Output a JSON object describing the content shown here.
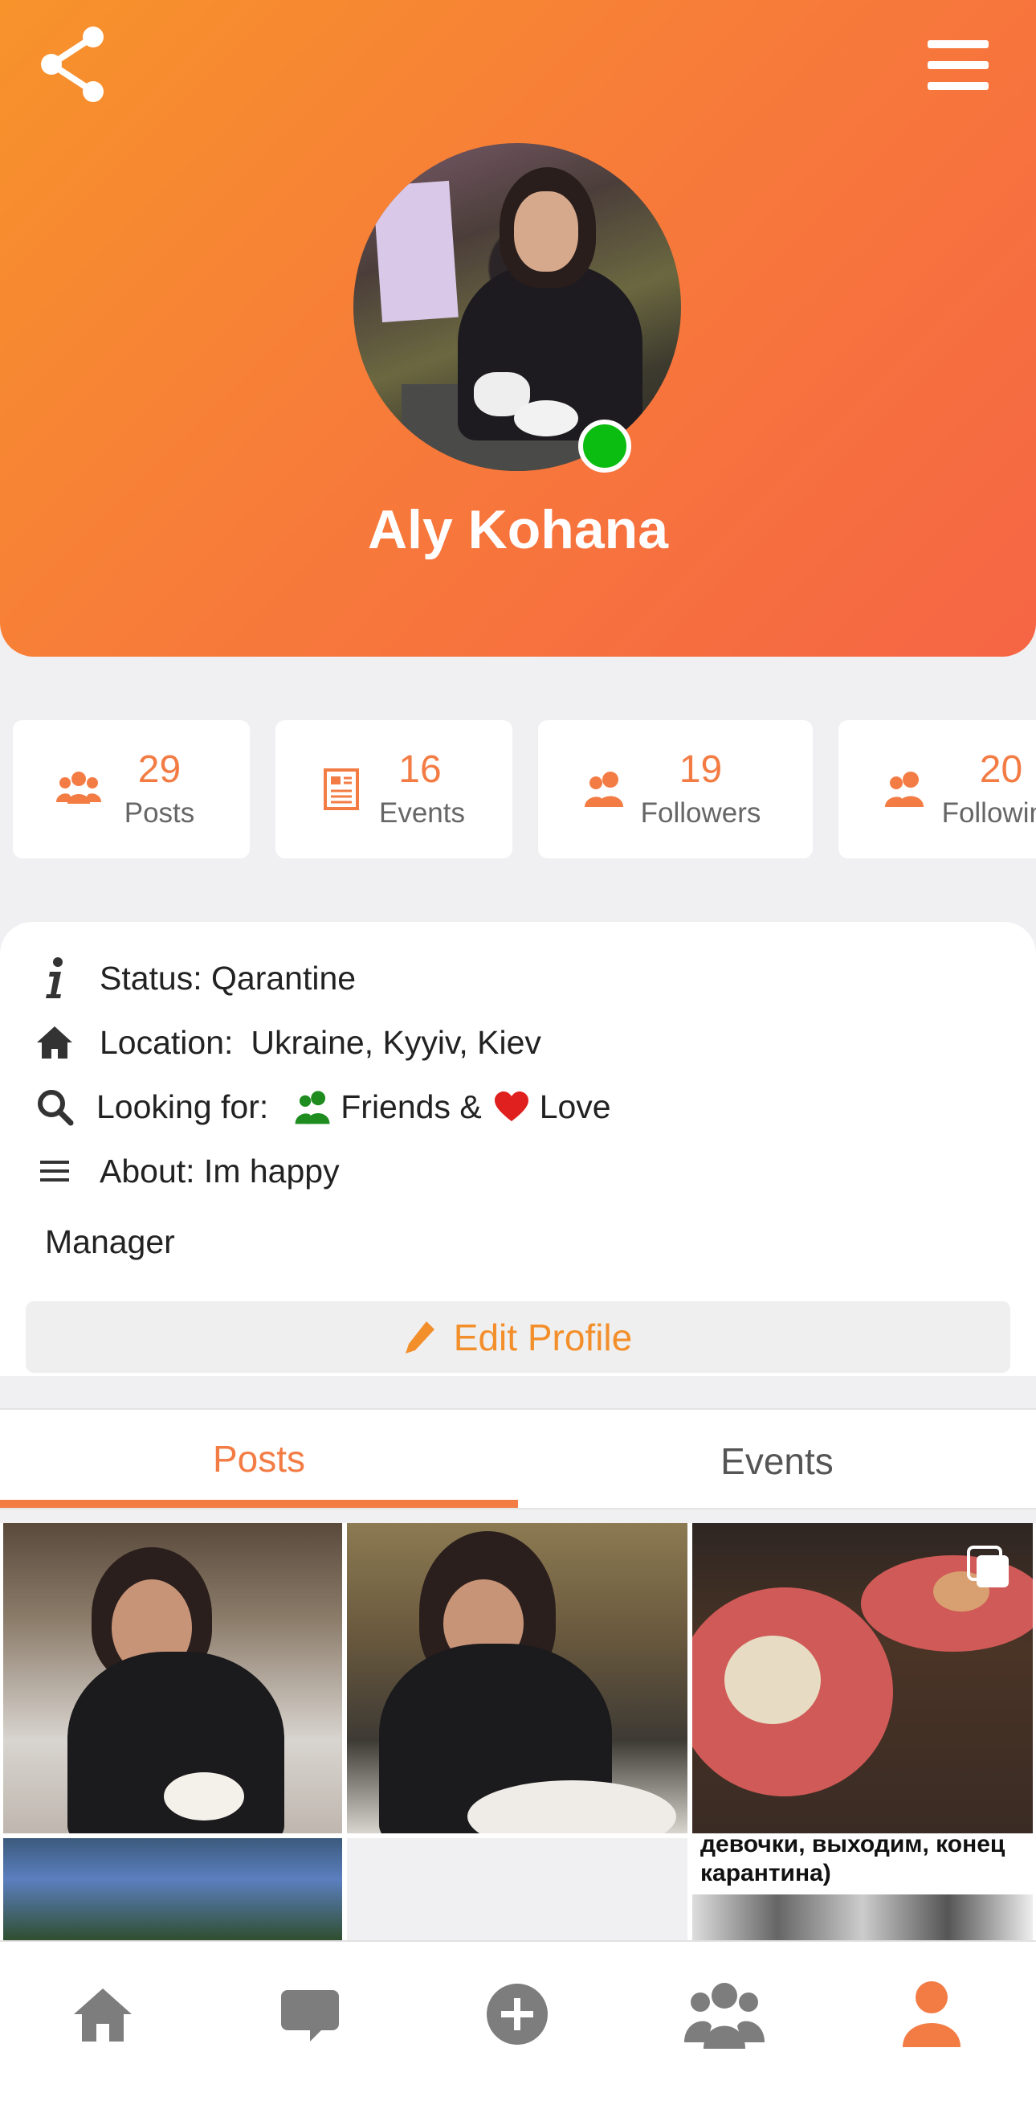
{
  "profile": {
    "name": "Aly Kohana",
    "online": true
  },
  "stats": [
    {
      "icon": "group-icon",
      "count": "29",
      "label": "Posts"
    },
    {
      "icon": "newspaper-icon",
      "count": "16",
      "label": "Events"
    },
    {
      "icon": "user-follow-icon",
      "count": "19",
      "label": "Followers"
    },
    {
      "icon": "user-follow-icon",
      "count": "20",
      "label": "Following"
    }
  ],
  "info": {
    "status": "Status: Qarantine",
    "location_label": "Location:",
    "location_value": "Ukraine, Kyyiv, Kiev",
    "looking_label": "Looking for:",
    "looking_friends": "Friends &",
    "looking_love": "Love",
    "about": "About: Im happy",
    "occupation": "Manager"
  },
  "edit_button": {
    "label": "Edit Profile"
  },
  "tabs": [
    {
      "label": "Posts",
      "active": true
    },
    {
      "label": "Events",
      "active": false
    }
  ],
  "posts": {
    "caption_line1": "девочки, выходим, конец",
    "caption_line2": "карантина)"
  },
  "colors": {
    "accent": "#f37c45",
    "header_start": "#f7932b",
    "header_end": "#f66545",
    "online": "#0bbc11",
    "friends_icon": "#1e8c1e",
    "love_icon": "#e01f1f",
    "edit_text": "#f38f2b"
  },
  "bottom_nav": [
    {
      "name": "home-icon",
      "active": false
    },
    {
      "name": "chat-icon",
      "active": false
    },
    {
      "name": "add-circle-icon",
      "active": false
    },
    {
      "name": "group-icon",
      "active": false
    },
    {
      "name": "profile-icon",
      "active": true
    }
  ]
}
